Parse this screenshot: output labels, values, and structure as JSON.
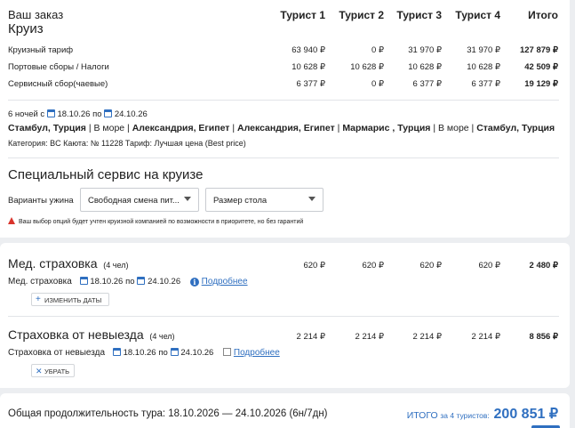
{
  "order": {
    "title": "Ваш заказ",
    "subtitle": "Круиз",
    "columns": [
      "Турист 1",
      "Турист 2",
      "Турист 3",
      "Турист 4",
      "Итого"
    ],
    "rows": [
      {
        "label": "Круизный тариф",
        "values": [
          "63 940 ₽",
          "0 ₽",
          "31 970 ₽",
          "31 970 ₽",
          "127 879 ₽"
        ]
      },
      {
        "label": "Портовые сборы / Налоги",
        "values": [
          "10 628 ₽",
          "10 628 ₽",
          "10 628 ₽",
          "10 628 ₽",
          "42 509 ₽"
        ]
      },
      {
        "label": "Сервисный сбор(чаевые)",
        "values": [
          "6 377 ₽",
          "0 ₽",
          "6 377 ₽",
          "6 377 ₽",
          "19 129 ₽"
        ]
      }
    ]
  },
  "cruise": {
    "nights": "6 ночей с",
    "date_from": "18.10.26",
    "by": "по",
    "date_to": "24.10.26",
    "route": [
      {
        "text": "Стамбул, Турция",
        "bold": true
      },
      {
        "text": " | В море | ",
        "bold": false
      },
      {
        "text": "Александрия, Египет",
        "bold": true
      },
      {
        "text": " | ",
        "bold": false
      },
      {
        "text": "Александрия, Египет",
        "bold": true
      },
      {
        "text": " | ",
        "bold": false
      },
      {
        "text": "Мармарис , Турция",
        "bold": true
      },
      {
        "text": " | В море | ",
        "bold": false
      },
      {
        "text": "Стамбул, Турция",
        "bold": true
      }
    ],
    "category": "Категория: BC  Каюта: № 11228  Тариф: Лучшая цена (Best price)"
  },
  "service": {
    "title": "Специальный сервис на круизе",
    "dinner_label": "Варианты ужина",
    "dinner_value": "Свободная смена пит...",
    "table_value": "Размер стола",
    "warning": "Ваш выбор опций будет учтен круизной компанией по возможности в приоритете, но без гарантий"
  },
  "insurance": {
    "title": "Мед. страховка",
    "count": "(4 чел)",
    "values": [
      "620 ₽",
      "620 ₽",
      "620 ₽",
      "620 ₽",
      "2 480 ₽"
    ],
    "sub_label": "Мед. страховка",
    "date_from": "18.10.26",
    "by": "по",
    "date_to": "24.10.26",
    "details_link": "Подробнее",
    "change_button": "ИЗМЕНИТЬ ДАТЫ"
  },
  "cancel_insurance": {
    "title": "Страховка от невыезда",
    "count": "(4 чел)",
    "values": [
      "2 214 ₽",
      "2 214 ₽",
      "2 214 ₽",
      "2 214 ₽",
      "8 856 ₽"
    ],
    "sub_label": "Страховка от невыезда",
    "date_from": "18.10.26",
    "by": "по",
    "date_to": "24.10.26",
    "details_link": "Подробнее",
    "remove_button": "УБРАТЬ"
  },
  "footer": {
    "duration": "Общая продолжительность тура: 18.10.2026 — 24.10.2026 (6н/7дн)",
    "total_label": "ИТОГО",
    "total_for": "за 4 туристов:",
    "total_value": "200 851 ₽"
  },
  "colors": {
    "accent": "#2f6fc0",
    "warning": "#d9342b"
  }
}
